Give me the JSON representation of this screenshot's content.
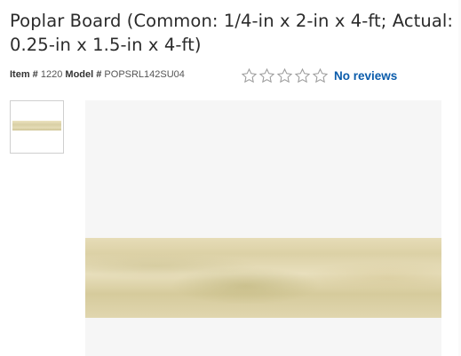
{
  "product": {
    "title": "Poplar Board (Common: 1/4-in x 2-in x 4-ft; Actual: 0.25-in x 1.5-in x 4-ft)",
    "item_label": "Item #",
    "item_number": "1220",
    "model_label": "Model #",
    "model_number": "POPSRL142SU04"
  },
  "rating": {
    "stars_total": 5,
    "stars_filled": 0,
    "reviews_text": "No reviews",
    "icon": "star-outline-icon"
  },
  "gallery": {
    "thumbnail_count": 1,
    "selected_index": 0
  },
  "colors": {
    "link": "#0b5cab",
    "title": "#2b2b2b",
    "star_outline": "#9a9a9a"
  }
}
